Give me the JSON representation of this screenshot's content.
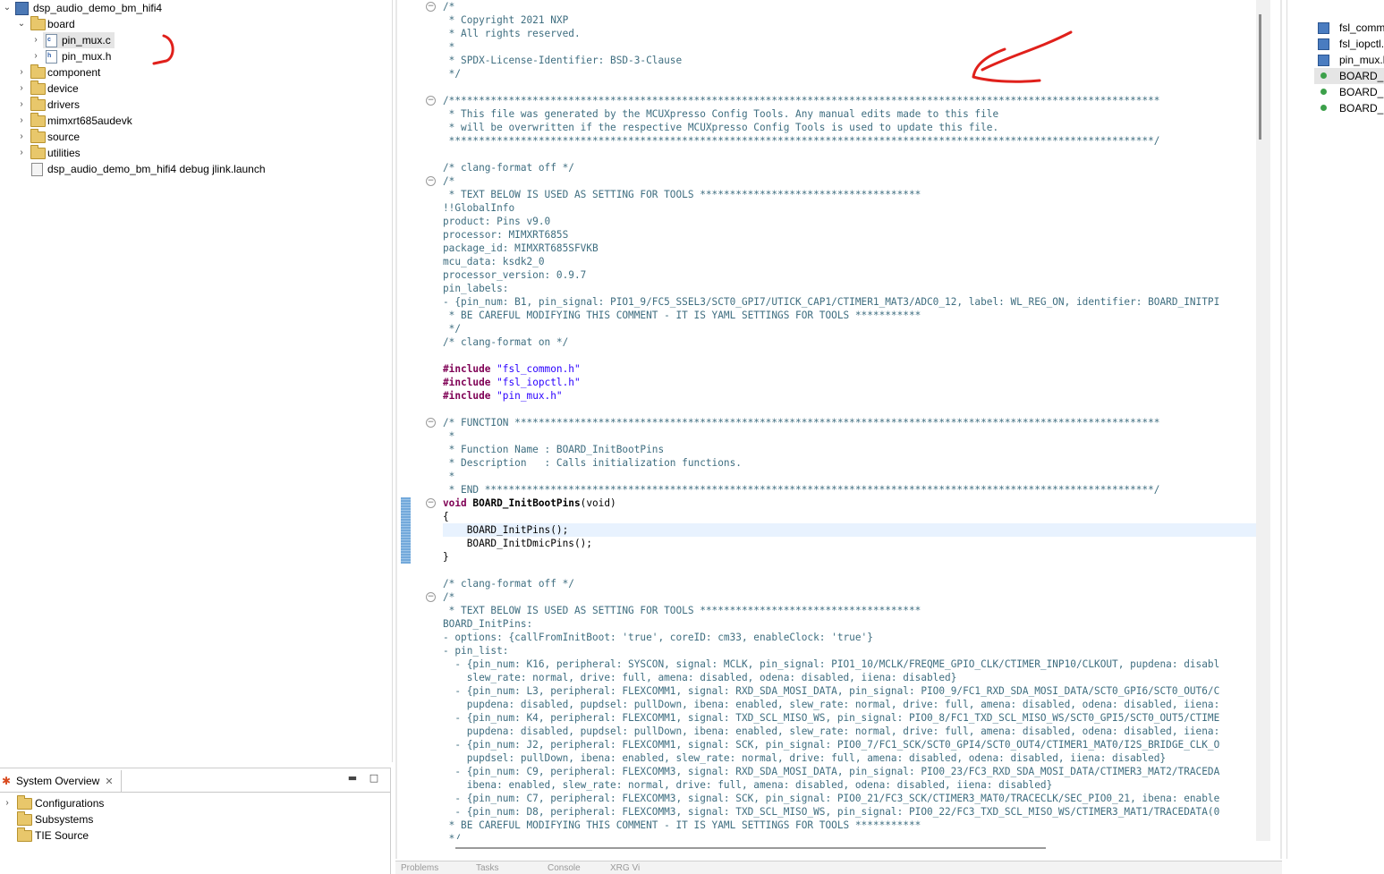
{
  "explorer": {
    "items": [
      {
        "label": "dsp_audio_demo_bm_hifi4",
        "kind": "project"
      },
      {
        "label": "board",
        "kind": "folder"
      },
      {
        "label": "pin_mux.c",
        "kind": "file-c"
      },
      {
        "label": "pin_mux.h",
        "kind": "file-h"
      },
      {
        "label": "component",
        "kind": "folder"
      },
      {
        "label": "device",
        "kind": "folder"
      },
      {
        "label": "drivers",
        "kind": "folder"
      },
      {
        "label": "mimxrt685audevk",
        "kind": "folder"
      },
      {
        "label": "source",
        "kind": "folder"
      },
      {
        "label": "utilities",
        "kind": "folder"
      },
      {
        "label": "dsp_audio_demo_bm_hifi4 debug jlink.launch",
        "kind": "launch"
      }
    ]
  },
  "system_overview": {
    "tab_label": "System Overview",
    "items": [
      "Configurations",
      "Subsystems",
      "TIE Source"
    ]
  },
  "editor": {
    "lines": [
      "/*",
      " * Copyright 2021 NXP",
      " * All rights reserved.",
      " *",
      " * SPDX-License-Identifier: BSD-3-Clause",
      " */",
      "",
      "/***********************************************************************************************************************",
      " * This file was generated by the MCUXpresso Config Tools. Any manual edits made to this file",
      " * will be overwritten if the respective MCUXpresso Config Tools is used to update this file.",
      " **********************************************************************************************************************/",
      "",
      "/* clang-format off */",
      "/*",
      " * TEXT BELOW IS USED AS SETTING FOR TOOLS *************************************",
      "!!GlobalInfo",
      "product: Pins v9.0",
      "processor: MIMXRT685S",
      "package_id: MIMXRT685SFVKB",
      "mcu_data: ksdk2_0",
      "processor_version: 0.9.7",
      "pin_labels:",
      "- {pin_num: B1, pin_signal: PIO1_9/FC5_SSEL3/SCT0_GPI7/UTICK_CAP1/CTIMER1_MAT3/ADC0_12, label: WL_REG_ON, identifier: BOARD_INITPI",
      " * BE CAREFUL MODIFYING THIS COMMENT - IT IS YAML SETTINGS FOR TOOLS ***********",
      " */",
      "/* clang-format on */",
      "",
      "#include \"fsl_common.h\"",
      "#include \"fsl_iopctl.h\"",
      "#include \"pin_mux.h\"",
      "",
      "/* FUNCTION ************************************************************************************************************",
      " *",
      " * Function Name : BOARD_InitBootPins",
      " * Description   : Calls initialization functions.",
      " *",
      " * END ****************************************************************************************************************/",
      "void BOARD_InitBootPins(void)",
      "{",
      "    BOARD_InitPins();",
      "    BOARD_InitDmicPins();",
      "}",
      "",
      "/* clang-format off */",
      "/*",
      " * TEXT BELOW IS USED AS SETTING FOR TOOLS *************************************",
      "BOARD_InitPins:",
      "- options: {callFromInitBoot: 'true', coreID: cm33, enableClock: 'true'}",
      "- pin_list:",
      "  - {pin_num: K16, peripheral: SYSCON, signal: MCLK, pin_signal: PIO1_10/MCLK/FREQME_GPIO_CLK/CTIMER_INP10/CLKOUT, pupdena: disabl",
      "    slew_rate: normal, drive: full, amena: disabled, odena: disabled, iiena: disabled}",
      "  - {pin_num: L3, peripheral: FLEXCOMM1, signal: RXD_SDA_MOSI_DATA, pin_signal: PIO0_9/FC1_RXD_SDA_MOSI_DATA/SCT0_GPI6/SCT0_OUT6/C",
      "    pupdena: disabled, pupdsel: pullDown, ibena: enabled, slew_rate: normal, drive: full, amena: disabled, odena: disabled, iiena:",
      "  - {pin_num: K4, peripheral: FLEXCOMM1, signal: TXD_SCL_MISO_WS, pin_signal: PIO0_8/FC1_TXD_SCL_MISO_WS/SCT0_GPI5/SCT0_OUT5/CTIME",
      "    pupdena: disabled, pupdsel: pullDown, ibena: enabled, slew_rate: normal, drive: full, amena: disabled, odena: disabled, iiena:",
      "  - {pin_num: J2, peripheral: FLEXCOMM1, signal: SCK, pin_signal: PIO0_7/FC1_SCK/SCT0_GPI4/SCT0_OUT4/CTIMER1_MAT0/I2S_BRIDGE_CLK_O",
      "    pupdsel: pullDown, ibena: enabled, slew_rate: normal, drive: full, amena: disabled, odena: disabled, iiena: disabled}",
      "  - {pin_num: C9, peripheral: FLEXCOMM3, signal: RXD_SDA_MOSI_DATA, pin_signal: PIO0_23/FC3_RXD_SDA_MOSI_DATA/CTIMER3_MAT2/TRACEDA",
      "    ibena: enabled, slew_rate: normal, drive: full, amena: disabled, odena: disabled, iiena: disabled}",
      "  - {pin_num: C7, peripheral: FLEXCOMM3, signal: SCK, pin_signal: PIO0_21/FC3_SCK/CTIMER3_MAT0/TRACECLK/SEC_PIO0_21, ibena: enable",
      "  - {pin_num: D8, peripheral: FLEXCOMM3, signal: TXD_SCL_MISO_WS, pin_signal: PIO0_22/FC3_TXD_SCL_MISO_WS/CTIMER3_MAT1/TRACEDATA(0",
      " * BE CAREFUL MODIFYING THIS COMMENT - IT IS YAML SETTINGS FOR TOOLS ***********",
      " */"
    ]
  },
  "outline": {
    "items": [
      {
        "label": "fsl_comm",
        "kind": "include"
      },
      {
        "label": "fsl_iopctl.",
        "kind": "include"
      },
      {
        "label": "pin_mux.l",
        "kind": "include"
      },
      {
        "label": "BOARD_Ir",
        "kind": "function"
      },
      {
        "label": "BOARD_Ir",
        "kind": "function"
      },
      {
        "label": "BOARD_Ir",
        "kind": "function"
      }
    ]
  },
  "bottom_tabs": [
    "Problems",
    "Tasks",
    "Console",
    "XRG Vi"
  ],
  "colors": {
    "annotation": "#e0201b",
    "comment": "#3f6e80",
    "keyword": "#7f0055",
    "string": "#2a00ff"
  }
}
